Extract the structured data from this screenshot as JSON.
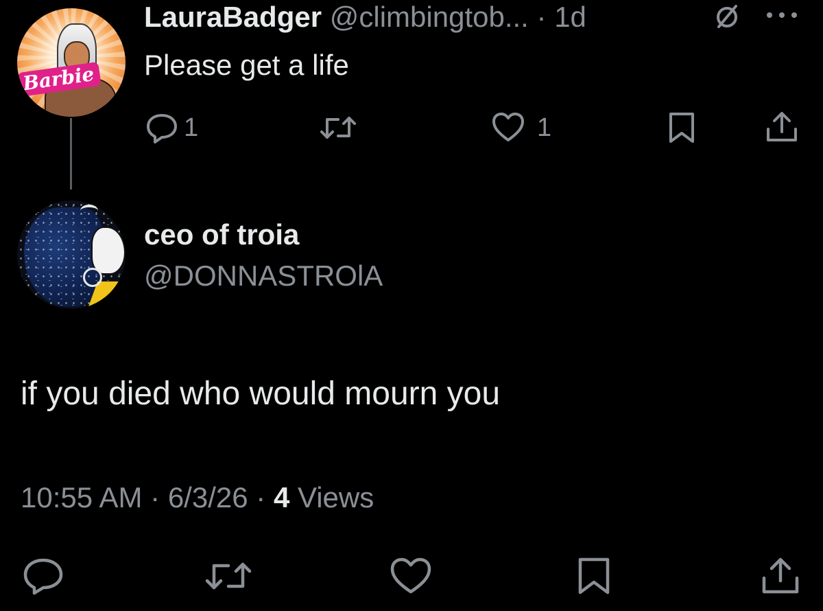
{
  "parent_tweet": {
    "author_name": "LauraBadger",
    "handle": "@climbingtob...",
    "separator": "·",
    "time_ago": "1d",
    "text": "Please get a life",
    "avatar_label": "Barbie",
    "icons": {
      "grok": "slashed-circle-icon",
      "more": "more-dots-icon"
    },
    "actions": {
      "reply_count": "1",
      "retweet_count": "",
      "like_count": "1"
    }
  },
  "main_tweet": {
    "author_name": "ceo of troia",
    "handle": "@DONNASTROlA",
    "text": "if you died who would mourn you",
    "time": "10:55 AM",
    "date": "6/3/26",
    "separator": "·",
    "views_count": "4",
    "views_label": "Views"
  },
  "colors": {
    "background": "#000000",
    "primary_text": "#e7e9ea",
    "secondary_text": "#8b9096",
    "thread_line": "#5a5f63"
  }
}
